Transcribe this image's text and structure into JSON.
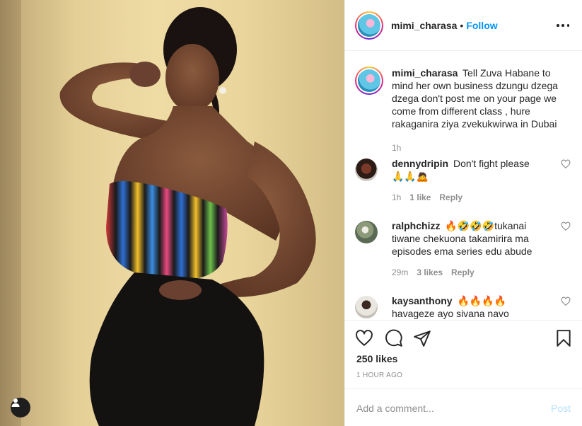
{
  "post": {
    "username": "mimi_charasa",
    "separator": "•",
    "follow_label": "Follow",
    "caption": "Tell Zuva Habane to mind her own business dzungu dzega dzega don't post me on your page we come from different class , hure rakaganira ziya zvekukwirwa in Dubai",
    "caption_time": "1h",
    "likes": "250 likes",
    "posted_ago": "1 HOUR AGO"
  },
  "comments": [
    {
      "username": "dennydripin",
      "text": "Don't fight please 🙏🙏🙇",
      "time": "1h",
      "likes": "1 like",
      "reply": "Reply"
    },
    {
      "username": "ralphchizz",
      "text": "🔥🤣🤣🤣tukanai tiwane chekuona takamirira ma episodes ema series edu abude",
      "time": "29m",
      "likes": "3 likes",
      "reply": "Reply"
    },
    {
      "username": "kaysanthony",
      "text": "🔥🔥🔥🔥 havageze ayo sivana navo"
    }
  ],
  "composer": {
    "placeholder": "Add a comment...",
    "post_label": "Post"
  },
  "icons": {
    "more": "more-options-icon",
    "like": "heart-icon",
    "comment": "comment-icon",
    "share": "share-icon",
    "save": "bookmark-icon",
    "tags": "user-tag-icon"
  },
  "colors": {
    "link_blue": "#0095f6",
    "post_disabled": "#b2dffc",
    "secondary_text": "#8e8e8e"
  }
}
